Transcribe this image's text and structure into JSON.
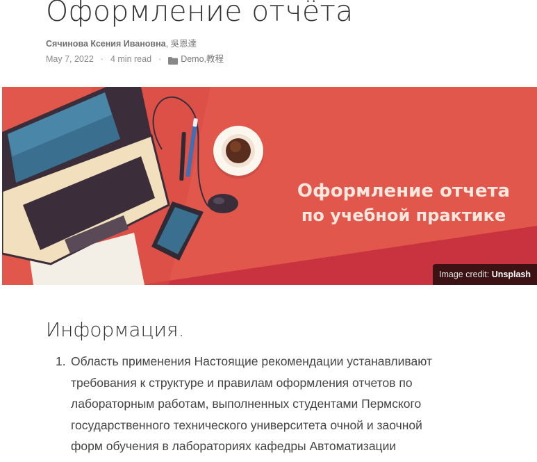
{
  "article": {
    "title": "Оформление отчёта",
    "authors": {
      "primary": "Сячинова Ксения Ивановна",
      "separator": ", ",
      "secondary": "吳恩達"
    },
    "meta": {
      "date": "May 7, 2022",
      "read_time": "4 min read",
      "dot": "·",
      "category_icon": "folder-icon",
      "categories": [
        "Demo",
        "教程"
      ],
      "category_separator": ", "
    },
    "hero_image": {
      "headline_line1": "Оформление отчета",
      "headline_line2": "по учебной практике",
      "credit_prefix": "Image credit: ",
      "credit_link": "Unsplash",
      "colors": {
        "background": "#e2574c",
        "background_dark": "#c9333f",
        "headline": "#fbe7dd"
      }
    },
    "section": {
      "heading": "Информация.",
      "list": [
        {
          "number": "1.",
          "lines": [
            "Область применения Настоящие рекомендации устанавливают",
            "требования к структуре и правилам оформления отчетов по",
            "лабораторным работам, выполненных студентами Пермского",
            "государственного технического университета очной и заочной",
            "форм обучения в лабораториях кафедры Автоматизации"
          ]
        }
      ]
    }
  }
}
